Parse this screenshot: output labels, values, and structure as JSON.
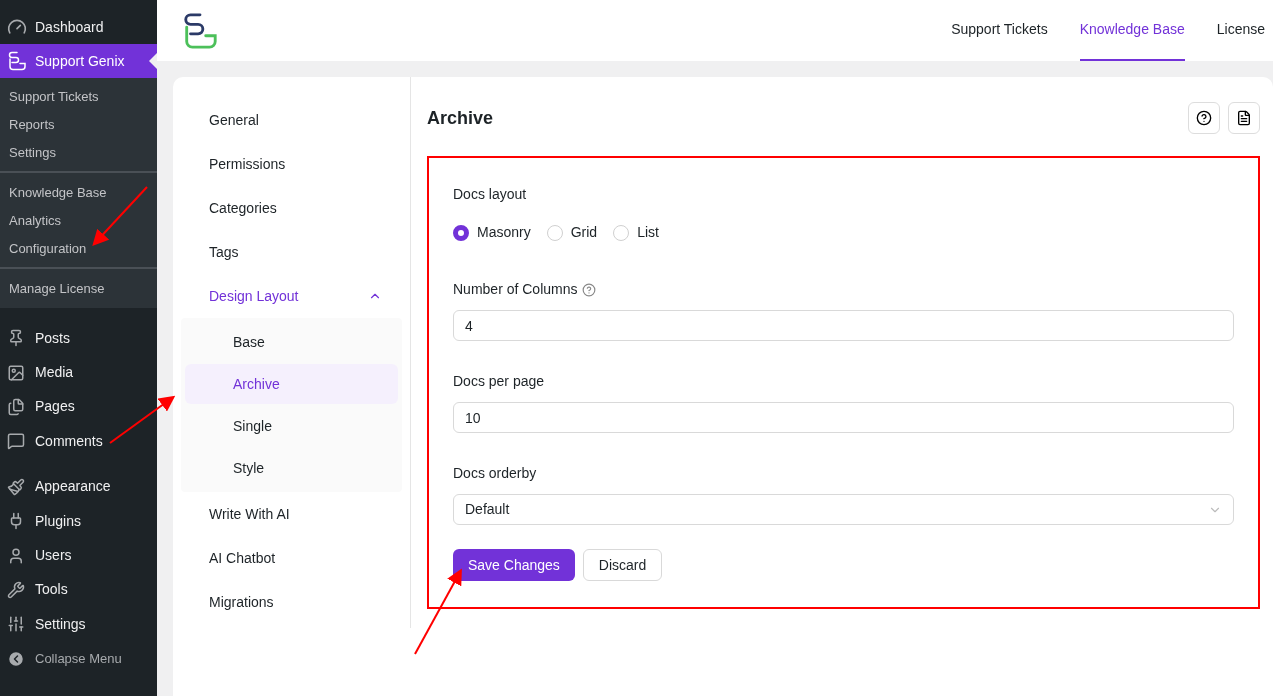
{
  "sidebar": {
    "top_items": [
      {
        "label": "Dashboard",
        "selected": false
      },
      {
        "label": "Support Genix",
        "selected": true
      }
    ],
    "submenu_groups": [
      [
        "Support Tickets",
        "Reports",
        "Settings"
      ],
      [
        "Knowledge Base",
        "Analytics",
        "Configuration"
      ],
      [
        "Manage License"
      ]
    ],
    "menu_groups": [
      [
        "Posts",
        "Media",
        "Pages",
        "Comments"
      ],
      [
        "Appearance",
        "Plugins",
        "Users",
        "Tools",
        "Settings"
      ]
    ],
    "collapse": "Collapse Menu"
  },
  "header": {
    "tabs": [
      {
        "label": "Support Tickets",
        "selected": false
      },
      {
        "label": "Knowledge Base",
        "selected": true
      },
      {
        "label": "License",
        "selected": false
      }
    ]
  },
  "settings_nav": [
    {
      "label": "General",
      "selected": false
    },
    {
      "label": "Permissions",
      "selected": false
    },
    {
      "label": "Categories",
      "selected": false
    },
    {
      "label": "Tags",
      "selected": false
    },
    {
      "label": "Design Layout",
      "selected": true,
      "expanded": true,
      "children": [
        {
          "label": "Base",
          "selected": false
        },
        {
          "label": "Archive",
          "selected": true
        },
        {
          "label": "Single",
          "selected": false
        },
        {
          "label": "Style",
          "selected": false
        }
      ]
    },
    {
      "label": "Write With AI",
      "selected": false
    },
    {
      "label": "AI Chatbot",
      "selected": false
    },
    {
      "label": "Migrations",
      "selected": false
    }
  ],
  "panel": {
    "title": "Archive",
    "docs_layout": {
      "label": "Docs layout",
      "options": [
        {
          "label": "Masonry",
          "selected": true
        },
        {
          "label": "Grid",
          "selected": false
        },
        {
          "label": "List",
          "selected": false
        }
      ]
    },
    "columns": {
      "label": "Number of Columns",
      "value": "4"
    },
    "per_page": {
      "label": "Docs per page",
      "value": "10"
    },
    "orderby": {
      "label": "Docs orderby",
      "value": "Default"
    },
    "buttons": {
      "save": "Save Changes",
      "discard": "Discard"
    }
  }
}
